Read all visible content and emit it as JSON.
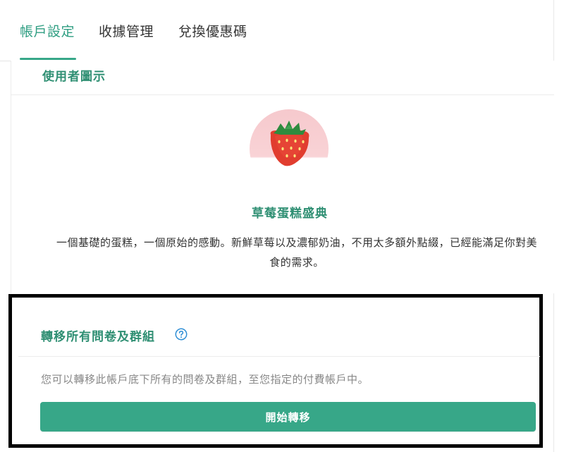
{
  "tabs": [
    {
      "label": "帳戶設定",
      "active": true
    },
    {
      "label": "收據管理",
      "active": false
    },
    {
      "label": "兌換優惠碼",
      "active": false
    }
  ],
  "avatar_section": {
    "title": "使用者圖示",
    "avatar_icon": "strawberry-icon",
    "avatar_name": "草莓蛋糕盛典",
    "description": "一個基礎的蛋糕，一個原始的感動。新鮮草莓以及濃郁奶油，不用太多額外點綴，已經能滿足你對美食的需求。"
  },
  "transfer_section": {
    "title": "轉移所有問卷及群組",
    "help_icon": "question-circle-icon",
    "description": "您可以轉移此帳戶底下所有的問卷及群組，至您指定的付費帳戶中。",
    "button_label": "開始轉移"
  },
  "colors": {
    "accent": "#37a788",
    "accent_text": "#2f8f73",
    "avatar_background": "#f6c9cd",
    "highlight_outline": "#000000"
  }
}
